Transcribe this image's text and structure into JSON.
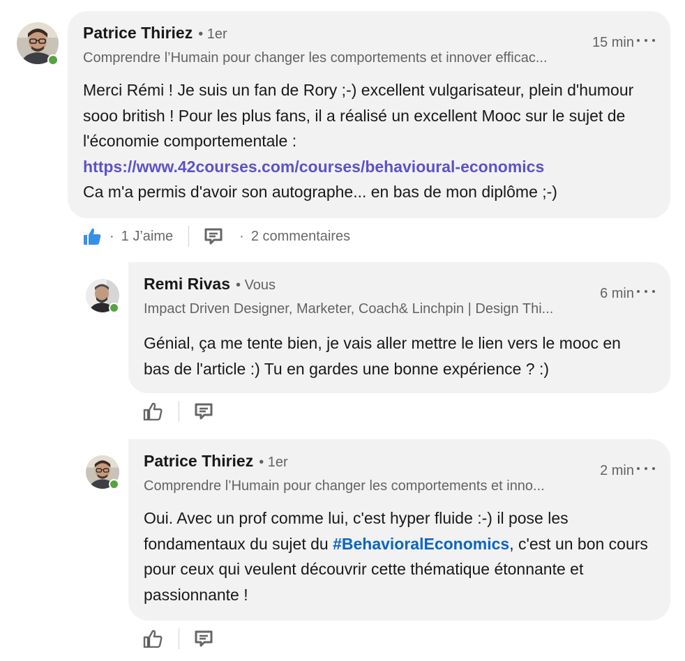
{
  "comments": [
    {
      "author": "Patrice Thiriez",
      "degree": "• 1er",
      "headline": "Comprendre l’Humain pour changer les comportements et innover efficac...",
      "time": "15 min",
      "text": {
        "intro": "Merci Rémi ! Je suis un fan de Rory ;-) excellent vulgarisateur, plein d'humour sooo british ! Pour les plus fans, il a réalisé un excellent Mooc sur le sujet de l'économie comportementale :",
        "link": "https://www.42courses.com/courses/behavioural-economics",
        "outro": "Ca m'a permis d'avoir son autographe... en bas de mon diplôme ;-)"
      },
      "reactions": {
        "like_count": "1 J’aime",
        "comment_count": "2 commentaires"
      }
    },
    {
      "author": "Remi Rivas",
      "degree": "• Vous",
      "headline": "Impact Driven Designer, Marketer, Coach& Linchpin | Design Thi...",
      "time": "6 min",
      "text": "Génial, ça me tente bien, je vais aller mettre le lien vers le mooc en bas de l'article :) Tu en gardes une bonne expérience ? :)"
    },
    {
      "author": "Patrice Thiriez",
      "degree": "• 1er",
      "headline": "Comprendre l’Humain pour changer les comportements et inno...",
      "time": "2 min",
      "text": {
        "before": "Oui. Avec un prof comme lui, c'est hyper fluide :-) il pose les fondamentaux du sujet du ",
        "hashtag": "#BehavioralEconomics",
        "after": ", c'est un bon cours pour ceux qui veulent découvrir cette thématique étonnante et passionnante !"
      }
    }
  ],
  "separators": {
    "dot": "·"
  },
  "icons": {
    "like_filled": "thumbs-up-filled-icon",
    "like_outline": "thumbs-up-outline-icon",
    "comment": "comment-icon",
    "more": "more-horizontal-icon"
  },
  "colors": {
    "link": "#5c53c7",
    "hashtag": "#0a66c2",
    "like_blue": "#378fe9",
    "presence_green": "#57a33f",
    "bubble_bg": "#f2f2f2"
  }
}
